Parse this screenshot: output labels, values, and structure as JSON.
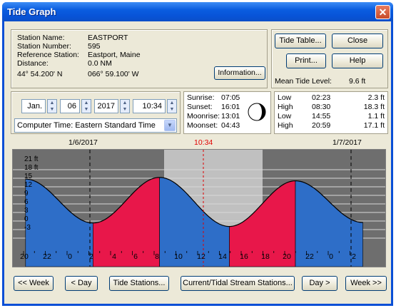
{
  "window": {
    "title": "Tide Graph"
  },
  "station": {
    "name_label": "Station Name:",
    "name": "EASTPORT",
    "number_label": "Station Number:",
    "number": "595",
    "ref_label": "Reference Station:",
    "ref": "Eastport, Maine",
    "distance_label": "Distance:",
    "distance": "0.0 NM",
    "lat": "44° 54.200' N",
    "lon": "066° 59.100' W",
    "info_button": "Information..."
  },
  "buttons": {
    "tide_table": "Tide Table...",
    "close": "Close",
    "print": "Print...",
    "help": "Help"
  },
  "mean_tide": {
    "label": "Mean Tide Level:",
    "value": "9.6 ft"
  },
  "date": {
    "month": "Jan.",
    "day": "06",
    "year": "2017",
    "time": "10:34",
    "timezone": "Computer Time: Eastern Standard Time"
  },
  "astro": [
    {
      "label": "Sunrise:",
      "value": "07:05"
    },
    {
      "label": "Sunset:",
      "value": "16:01"
    },
    {
      "label": "Moonrise:",
      "value": "13:01"
    },
    {
      "label": "Moonset:",
      "value": "04:43"
    }
  ],
  "tides": [
    {
      "type": "Low",
      "time": "02:23",
      "height": "2.3 ft"
    },
    {
      "type": "High",
      "time": "08:30",
      "height": "18.3 ft"
    },
    {
      "type": "Low",
      "time": "14:55",
      "height": "1.1 ft"
    },
    {
      "type": "High",
      "time": "20:59",
      "height": "17.1 ft"
    }
  ],
  "graph": {
    "date_left": "1/6/2017",
    "current_time": "10:34",
    "date_right": "1/7/2017",
    "y_labels": [
      "21 ft",
      "18 ft",
      "15",
      "12",
      "9",
      "6",
      "3",
      "0",
      "-3"
    ],
    "x_labels": [
      "20",
      "22",
      "0",
      "2",
      "4",
      "6",
      "8",
      "10",
      "12",
      "14",
      "16",
      "18",
      "20",
      "22",
      "0",
      "2"
    ],
    "colors": {
      "rising": "#e8174a",
      "falling": "#2e6ec8",
      "night": "#6e6e6e",
      "day": "#c0c0c0"
    }
  },
  "nav": {
    "week_back": "<< Week",
    "day_back": "< Day",
    "tide_stations": "Tide Stations...",
    "current_stations": "Current/Tidal Stream Stations...",
    "day_fwd": "Day >",
    "week_fwd": "Week >>"
  }
}
